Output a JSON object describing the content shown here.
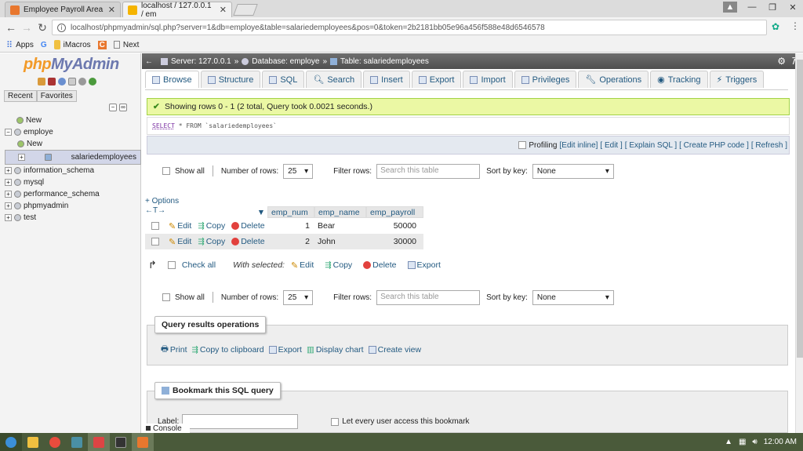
{
  "browser": {
    "tabs": [
      {
        "title": "Employee Payroll Area",
        "color": "#e8772e"
      },
      {
        "title": "localhost / 127.0.0.1 / em",
        "color": "#f5b400"
      }
    ],
    "url": "localhost/phpmyadmin/sql.php?server=1&db=employe&table=salariedemployees&pos=0&token=2b2181bb05e96a456f588e48d6546578",
    "bookmarks": [
      "Apps",
      "G",
      "iMacros",
      "C",
      "Next"
    ]
  },
  "sidebar": {
    "logo_php": "php",
    "logo_myadmin": "MyAdmin",
    "recent": "Recent",
    "favorites": "Favorites",
    "tree": [
      {
        "label": "New",
        "level": 0
      },
      {
        "label": "employe",
        "level": 0
      },
      {
        "label": "New",
        "level": 1
      },
      {
        "label": "salariedemployees",
        "level": 1
      },
      {
        "label": "information_schema",
        "level": 0
      },
      {
        "label": "mysql",
        "level": 0
      },
      {
        "label": "performance_schema",
        "level": 0
      },
      {
        "label": "phpmyadmin",
        "level": 0
      },
      {
        "label": "test",
        "level": 0
      }
    ]
  },
  "crumb": {
    "server": "Server: 127.0.0.1",
    "sep1": "»",
    "database": "Database: employe",
    "sep2": "»",
    "table": "Table: salariedemployees"
  },
  "tabs": [
    "Browse",
    "Structure",
    "SQL",
    "Search",
    "Insert",
    "Export",
    "Import",
    "Privileges",
    "Operations",
    "Tracking",
    "Triggers"
  ],
  "message": "Showing rows 0 - 1 (2 total, Query took 0.0021 seconds.)",
  "sql": {
    "kw1": "SELECT",
    "rest": "* FROM `salariedemployees`"
  },
  "profiling": {
    "label": "Profiling",
    "links": [
      "[Edit inline]",
      "[ Edit ]",
      "[ Explain SQL ]",
      "[ Create PHP code ]",
      "[ Refresh ]"
    ]
  },
  "nav": {
    "show_all": "Show all",
    "num_rows_label": "Number of rows:",
    "num_rows": "25",
    "filter_label": "Filter rows:",
    "filter_placeholder": "Search this table",
    "sort_label": "Sort by key:",
    "sort_value": "None"
  },
  "options": "+ Options",
  "table": {
    "columns": [
      "emp_num",
      "emp_name",
      "emp_payroll"
    ],
    "rows": [
      {
        "emp_num": "1",
        "emp_name": "Bear",
        "emp_payroll": "50000"
      },
      {
        "emp_num": "2",
        "emp_name": "John",
        "emp_payroll": "30000"
      }
    ],
    "edit": "Edit",
    "copy": "Copy",
    "delete": "Delete"
  },
  "bulk": {
    "check_all": "Check all",
    "with_selected": "With selected:",
    "edit": "Edit",
    "copy": "Copy",
    "delete": "Delete",
    "export": "Export"
  },
  "query_ops": {
    "title": "Query results operations",
    "print": "Print",
    "clipboard": "Copy to clipboard",
    "export": "Export",
    "chart": "Display chart",
    "view": "Create view"
  },
  "bookmark": {
    "title": "Bookmark this SQL query",
    "label": "Label:",
    "public": "Let every user access this bookmark"
  },
  "console": "Console",
  "taskbar": {
    "time": "12:00 AM"
  }
}
